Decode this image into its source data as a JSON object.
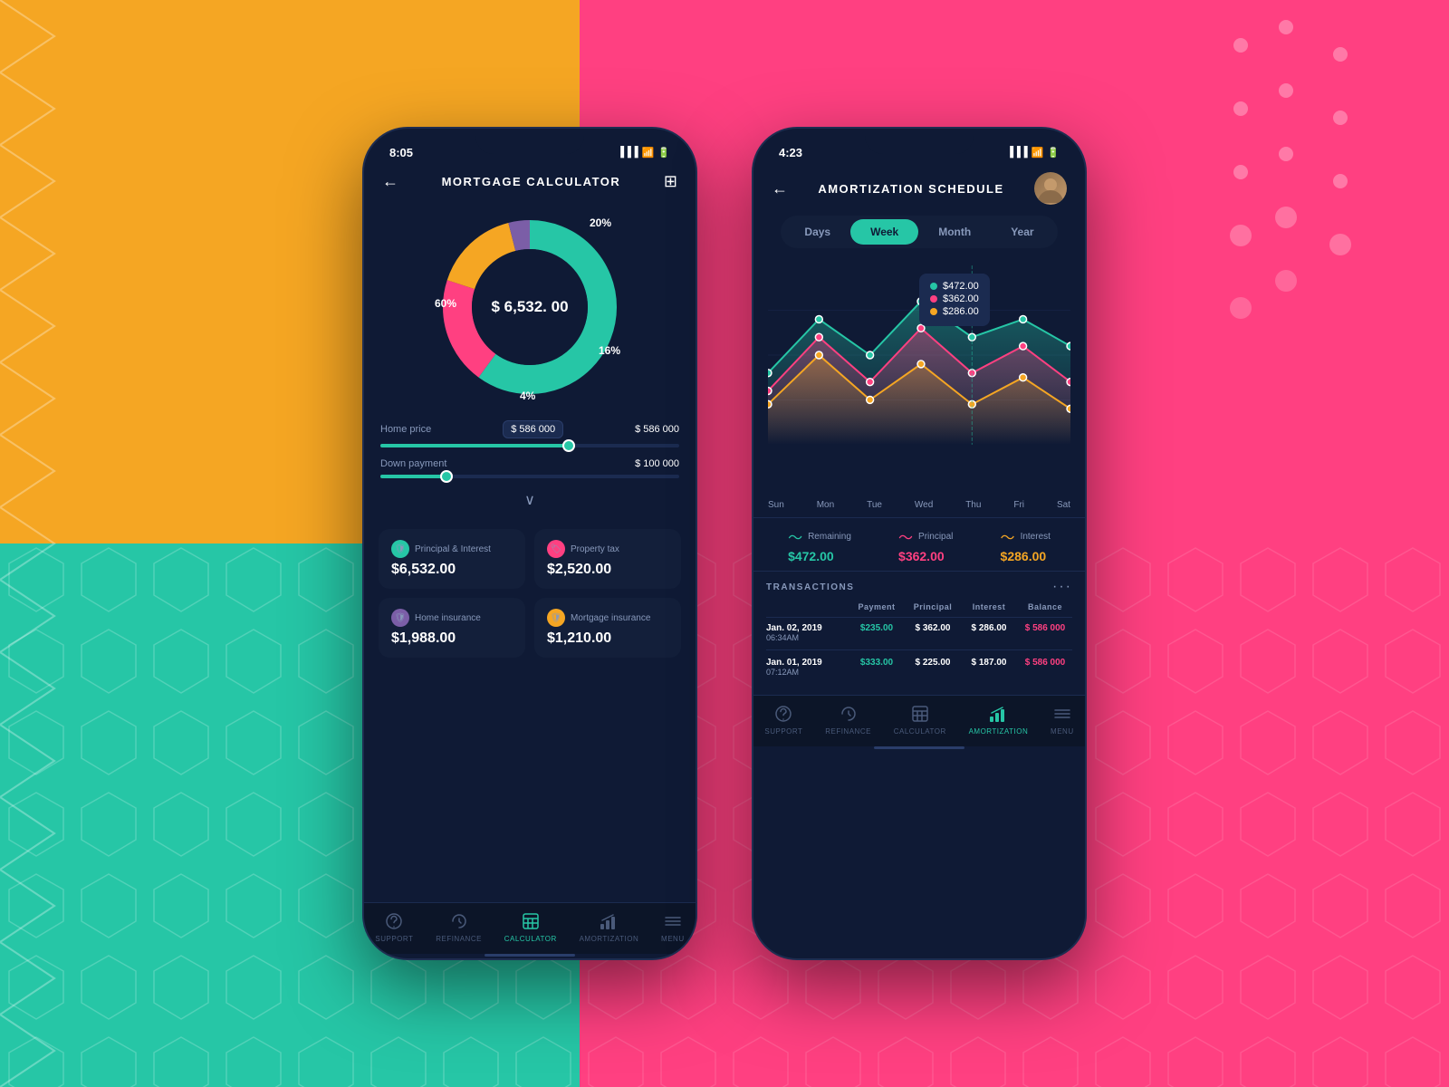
{
  "backgrounds": {
    "top_left": "#F5A623",
    "top_right": "#FF4081",
    "bottom_left": "#26C6A6",
    "bottom_right": "#FF4081"
  },
  "phone1": {
    "status_time": "8:05",
    "title": "MORTGAGE CALCULATOR",
    "donut": {
      "center_value": "$ 6,532. 00",
      "segments": [
        {
          "label": "60%",
          "color": "#26C6A6",
          "value": 60
        },
        {
          "label": "20%",
          "color": "#FF4081",
          "value": 20
        },
        {
          "label": "16%",
          "color": "#F5A623",
          "value": 16
        },
        {
          "label": "4%",
          "color": "#7B5EA7",
          "value": 4
        }
      ]
    },
    "home_price": {
      "label": "Home price",
      "badge_value": "$ 586 000",
      "value": "$ 586 000",
      "slider_pct": 63
    },
    "down_payment": {
      "label": "Down payment",
      "value": "$ 100 000",
      "slider_pct": 22
    },
    "cards": [
      {
        "icon": "shield-icon",
        "icon_color": "teal",
        "label": "Principal & Interest",
        "value": "$6,532.00"
      },
      {
        "icon": "tag-icon",
        "icon_color": "pink",
        "label": "Property tax",
        "value": "$2,520.00"
      },
      {
        "icon": "shield-icon",
        "icon_color": "purple",
        "label": "Home insurance",
        "value": "$1,988.00"
      },
      {
        "icon": "shield-icon",
        "icon_color": "orange",
        "label": "Mortgage insurance",
        "value": "$1,210.00"
      }
    ],
    "nav": [
      {
        "label": "SUPPORT",
        "active": false,
        "icon": "support-icon"
      },
      {
        "label": "REFINANCE",
        "active": false,
        "icon": "refinance-icon"
      },
      {
        "label": "CALCULATOR",
        "active": true,
        "icon": "calculator-icon"
      },
      {
        "label": "AMORTIZATION",
        "active": false,
        "icon": "amortization-icon"
      },
      {
        "label": "MENU",
        "active": false,
        "icon": "menu-icon"
      }
    ]
  },
  "phone2": {
    "status_time": "4:23",
    "title": "AMORTIZATION SCHEDULE",
    "tabs": [
      {
        "label": "Days",
        "active": false
      },
      {
        "label": "Week",
        "active": true
      },
      {
        "label": "Month",
        "active": false
      },
      {
        "label": "Year",
        "active": false
      }
    ],
    "chart": {
      "tooltip": {
        "items": [
          {
            "dot_color": "#26C6A6",
            "value": "$472.00"
          },
          {
            "dot_color": "#FF4081",
            "value": "$362.00"
          },
          {
            "dot_color": "#F5A623",
            "value": "$286.00"
          }
        ]
      },
      "day_labels": [
        "Sun",
        "Mon",
        "Tue",
        "Wed",
        "Thu",
        "Fri",
        "Sat"
      ]
    },
    "legend": [
      {
        "label": "Remaining",
        "value": "$472.00",
        "color": "#26C6A6"
      },
      {
        "label": "Principal",
        "value": "$362.00",
        "color": "#FF4081"
      },
      {
        "label": "Interest",
        "value": "$286.00",
        "color": "#F5A623"
      }
    ],
    "transactions": {
      "title": "TRANSACTIONS",
      "headers": [
        "",
        "Payment",
        "Principal",
        "Interest",
        "Balance"
      ],
      "rows": [
        {
          "date": "Jan. 02, 2019",
          "time": "06:34AM",
          "payment": "$235.00",
          "principal": "$ 362.00",
          "interest": "$ 286.00",
          "balance": "$ 586 000"
        },
        {
          "date": "Jan. 01, 2019",
          "time": "07:12AM",
          "payment": "$333.00",
          "principal": "$ 225.00",
          "interest": "$ 187.00",
          "balance": "$ 586 000"
        }
      ]
    },
    "nav": [
      {
        "label": "SUPPORT",
        "active": false,
        "icon": "support-icon"
      },
      {
        "label": "REFINANCE",
        "active": false,
        "icon": "refinance-icon"
      },
      {
        "label": "CALCULATOR",
        "active": false,
        "icon": "calculator-icon"
      },
      {
        "label": "AMORTIZATION",
        "active": true,
        "icon": "amortization-icon"
      },
      {
        "label": "MENU",
        "active": false,
        "icon": "menu-icon"
      }
    ]
  }
}
